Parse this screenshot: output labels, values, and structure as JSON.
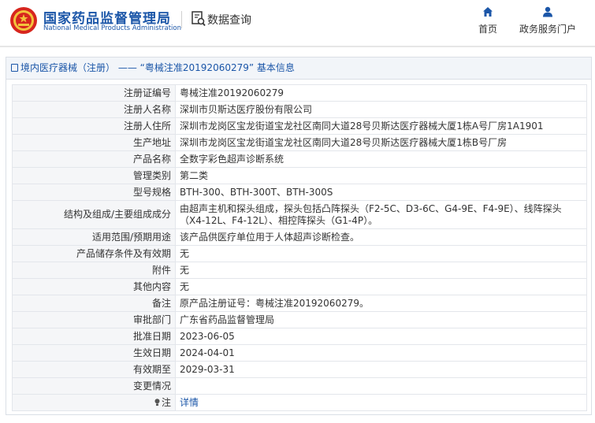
{
  "header": {
    "org_name_cn": "国家药品监督管理局",
    "org_name_en": "National Medical Products Administration",
    "query_label": "数据查询",
    "nav": {
      "home": "首页",
      "portal": "政务服务门户"
    }
  },
  "breadcrumb": {
    "section": "境内医疗器械（注册）",
    "dash": "——",
    "record": "“粤械注准20192060279”",
    "suffix": "基本信息"
  },
  "rows": [
    {
      "label": "注册证编号",
      "value": "粤械注准20192060279"
    },
    {
      "label": "注册人名称",
      "value": "深圳市贝斯达医疗股份有限公司"
    },
    {
      "label": "注册人住所",
      "value": "深圳市龙岗区宝龙街道宝龙社区南同大道28号贝斯达医疗器械大厦1栋A号厂房1A1901"
    },
    {
      "label": "生产地址",
      "value": "深圳市龙岗区宝龙街道宝龙社区南同大道28号贝斯达医疗器械大厦1栋B号厂房"
    },
    {
      "label": "产品名称",
      "value": "全数字彩色超声诊断系统"
    },
    {
      "label": "管理类别",
      "value": "第二类"
    },
    {
      "label": "型号规格",
      "value": "BTH-300、BTH-300T、BTH-300S"
    },
    {
      "label": "结构及组成/主要组成成分",
      "value": "由超声主机和探头组成，探头包括凸阵探头（F2-5C、D3-6C、G4-9E、F4-9E）、线阵探头（X4-12L、F4-12L）、相控阵探头（G1-4P）。"
    },
    {
      "label": "适用范围/预期用途",
      "value": "该产品供医疗单位用于人体超声诊断检查。"
    },
    {
      "label": "产品储存条件及有效期",
      "value": "无"
    },
    {
      "label": "附件",
      "value": "无"
    },
    {
      "label": "其他内容",
      "value": "无"
    },
    {
      "label": "备注",
      "value": "原产品注册证号：粤械注准20192060279。"
    },
    {
      "label": "审批部门",
      "value": "广东省药品监督管理局"
    },
    {
      "label": "批准日期",
      "value": "2023-06-05"
    },
    {
      "label": "生效日期",
      "value": "2024-04-01"
    },
    {
      "label": "有效期至",
      "value": "2029-03-31"
    },
    {
      "label": "变更情况",
      "value": ""
    }
  ],
  "note": {
    "label": "注",
    "link": "详情"
  },
  "colors": {
    "brand": "#1b56a8",
    "seal": "#d7261e"
  },
  "icons": {
    "logo": "national-emblem",
    "query": "search-document-icon",
    "home": "home-icon",
    "portal": "user-icon",
    "note": "lightbulb-icon"
  }
}
